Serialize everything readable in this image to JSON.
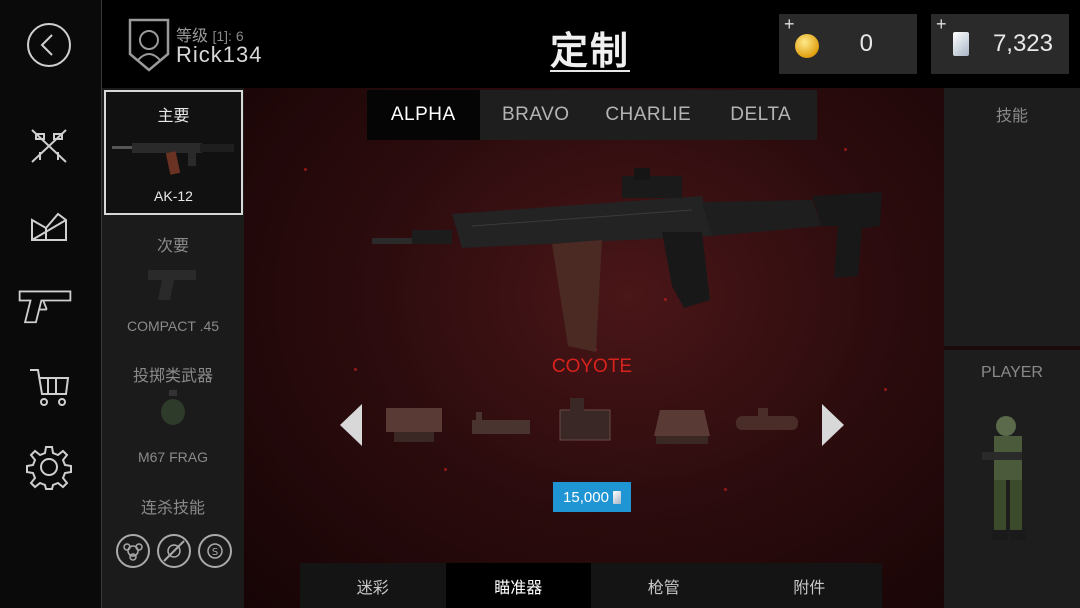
{
  "header": {
    "rank_label": "等级",
    "rank_value": "[1]: 6",
    "username": "Rick134",
    "title": "定制",
    "coins": "0",
    "cards": "7,323",
    "plus": "+"
  },
  "loadout": {
    "primary_label": "主要",
    "primary_name": "AK-12",
    "secondary_label": "次要",
    "secondary_name": "COMPACT .45",
    "throwable_label": "投掷类武器",
    "throwable_name": "M67 FRAG",
    "killstreak_label": "连杀技能"
  },
  "tabs": [
    "ALPHA",
    "BRAVO",
    "CHARLIE",
    "DELTA"
  ],
  "active_tab": "ALPHA",
  "weapon": {
    "skin_name": "COYOTE",
    "price": "15,000"
  },
  "bottom_tabs": [
    "迷彩",
    "瞄准器",
    "枪管",
    "附件"
  ],
  "active_bottom_tab": "瞄准器",
  "right": {
    "skill_title": "技能",
    "player_title": "PLAYER"
  },
  "icons": {
    "back": "back-icon",
    "nav": [
      "weapons-icon",
      "gear-crate-icon",
      "pistol-icon",
      "cart-icon",
      "settings-icon"
    ]
  },
  "colors": {
    "accent_red": "#d8221e",
    "price_blue": "#1f95d4"
  }
}
